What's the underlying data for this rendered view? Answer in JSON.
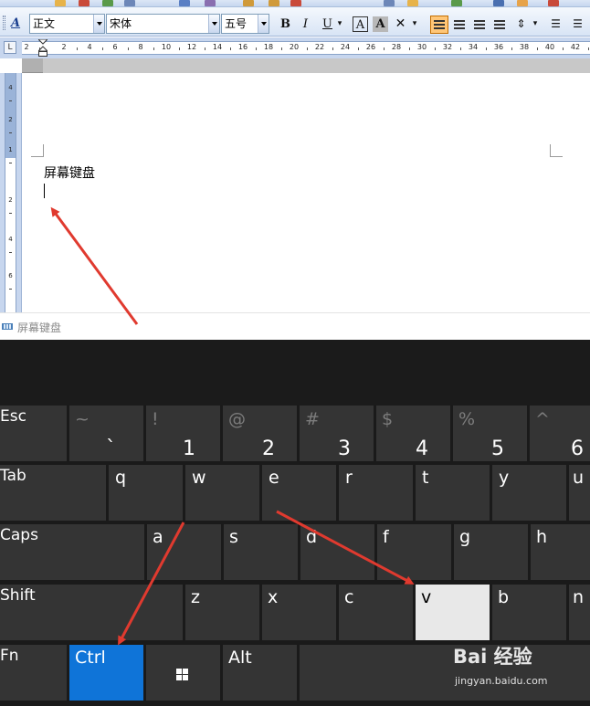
{
  "toolbar": {
    "style_value": "正文",
    "font_value": "宋体",
    "size_value": "五号",
    "bold": "B",
    "italic": "I",
    "underline": "U",
    "font_color_letter": "A",
    "highlight_letter": "A",
    "char_border_letter": "A"
  },
  "ruler": {
    "corner": "L",
    "h_numbers": [
      "2",
      "2",
      "4",
      "6",
      "8",
      "10",
      "12",
      "14",
      "16",
      "18",
      "20",
      "22",
      "24",
      "26",
      "28",
      "30",
      "32",
      "34",
      "36",
      "38",
      "40",
      "42"
    ],
    "v_numbers": [
      "4",
      "2",
      "1",
      "2",
      "4",
      "6"
    ]
  },
  "document": {
    "text": "屏幕键盘"
  },
  "taskbar": {
    "app_label": "屏幕键盘"
  },
  "keyboard": {
    "row1": [
      {
        "label": "Esc"
      },
      {
        "shift": "~",
        "main": "`"
      },
      {
        "shift": "!",
        "main": "1"
      },
      {
        "shift": "@",
        "main": "2"
      },
      {
        "shift": "#",
        "main": "3"
      },
      {
        "shift": "$",
        "main": "4"
      },
      {
        "shift": "%",
        "main": "5"
      },
      {
        "shift": "^",
        "main": "6"
      }
    ],
    "row2": [
      "Tab",
      "q",
      "w",
      "e",
      "r",
      "t",
      "y",
      "u"
    ],
    "row3": [
      "Caps",
      "a",
      "s",
      "d",
      "f",
      "g",
      "h"
    ],
    "row4": [
      "Shift",
      "z",
      "x",
      "c",
      "v",
      "b",
      "n"
    ],
    "row5": [
      "Fn",
      "Ctrl",
      "",
      "Alt",
      ""
    ],
    "pressed_key": "v",
    "accent_key": "Ctrl",
    "accent_color": "#0f74d8",
    "pressed_color": "#e8e8e8"
  },
  "annotations": {
    "arrow_color": "#e03a2f"
  },
  "watermark": {
    "logo": "Bai 经验",
    "url": "jingyan.baidu.com"
  }
}
